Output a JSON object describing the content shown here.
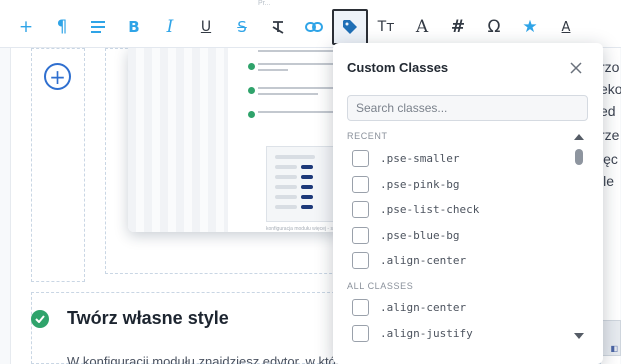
{
  "toolbar": {
    "tools": [
      {
        "name": "add-icon",
        "glyph": "+"
      },
      {
        "name": "paragraph-icon",
        "glyph": "¶"
      },
      {
        "name": "align-icon",
        "glyph": "≡"
      },
      {
        "name": "bold-icon",
        "glyph": "B"
      },
      {
        "name": "italic-icon",
        "glyph": "I"
      },
      {
        "name": "underline-icon",
        "glyph": "U"
      },
      {
        "name": "strikethrough-icon",
        "glyph": "S"
      },
      {
        "name": "clear-format-icon",
        "glyph": "T̶"
      },
      {
        "name": "link-icon",
        "glyph": "link"
      },
      {
        "name": "tag-icon",
        "glyph": "tag",
        "active": true
      },
      {
        "name": "text-size-icon",
        "glyph": "TT"
      },
      {
        "name": "font-icon",
        "glyph": "A"
      },
      {
        "name": "hash-icon",
        "glyph": "#"
      },
      {
        "name": "omega-icon",
        "glyph": "Ω"
      },
      {
        "name": "star-icon",
        "glyph": "★"
      },
      {
        "name": "text-color-icon",
        "glyph": "A"
      }
    ],
    "accent_color": "#2fa4e7"
  },
  "content": {
    "heading": "Twórz własne style",
    "body_snippet": "W konfiguracji modułu znajdziesz edytor, w którym możesz wpisywać",
    "right_fragments": [
      "rzo",
      "eko",
      "ed",
      "rze",
      "ięc",
      "ile"
    ],
    "screenshot_caption": "konfiguracja modułu więcej - stronie"
  },
  "popover": {
    "title": "Custom Classes",
    "search_placeholder": "Search classes...",
    "recent_label": "RECENT",
    "recent": [
      ".pse-smaller",
      ".pse-pink-bg",
      ".pse-list-check",
      ".pse-blue-bg",
      ".align-center"
    ],
    "all_label": "ALL CLASSES",
    "all": [
      ".align-center",
      ".align-justify"
    ]
  },
  "colors": {
    "success": "#2fa36b",
    "add_button": "#2f6fcf"
  }
}
